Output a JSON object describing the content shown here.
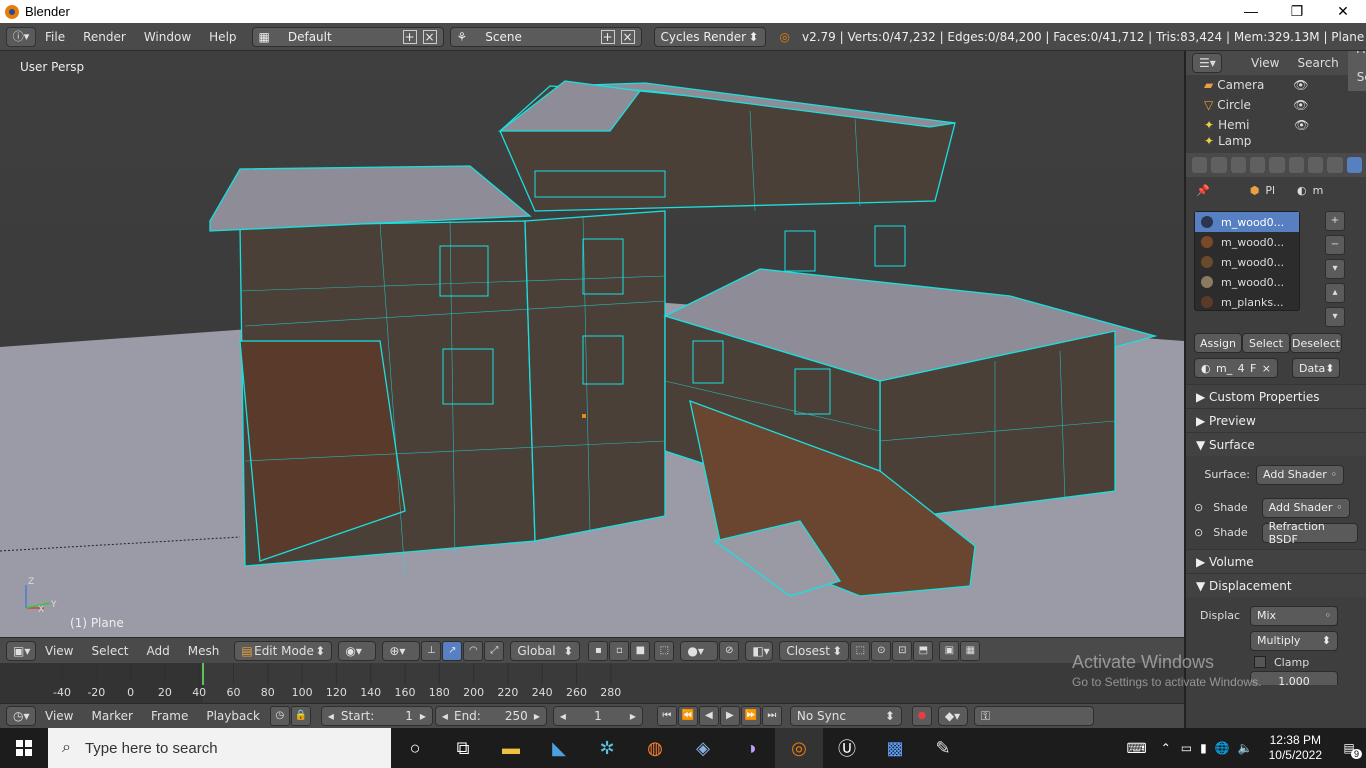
{
  "window": {
    "title": "Blender",
    "minimize": "—",
    "maximize": "❐",
    "close": "✕"
  },
  "infobar": {
    "menus": [
      "File",
      "Render",
      "Window",
      "Help"
    ],
    "screen_layout": "Default",
    "scene": "Scene",
    "render_engine": "Cycles Render",
    "stats": "v2.79 | Verts:0/47,232 | Edges:0/84,200 | Faces:0/41,712 | Tris:83,424 | Mem:329.13M | Plane"
  },
  "viewport": {
    "view_label": "User Persp",
    "object_label": "(1) Plane",
    "axis_x": "X",
    "axis_y": "Y",
    "axis_z": "Z"
  },
  "view_header": {
    "menus": [
      "View",
      "Select",
      "Add",
      "Mesh"
    ],
    "mode": "Edit Mode",
    "orientation": "Global",
    "snap_target": "Closest"
  },
  "timeline": {
    "ticks": [
      "-40",
      "-20",
      "0",
      "20",
      "40",
      "60",
      "80",
      "100",
      "120",
      "140",
      "160",
      "180",
      "200",
      "220",
      "240",
      "260",
      "280"
    ],
    "current_frame": 1
  },
  "timeline_header": {
    "menus": [
      "View",
      "Marker",
      "Frame",
      "Playback"
    ],
    "start_label": "Start:",
    "start_value": "1",
    "end_label": "End:",
    "end_value": "250",
    "current_value": "1",
    "sync": "No Sync"
  },
  "outliner": {
    "header": [
      "View",
      "Search",
      "All Sc"
    ],
    "items": [
      "Camera",
      "Circle",
      "Hemi",
      "Lamp"
    ]
  },
  "properties": {
    "breadcrumb": [
      "Pl",
      "m"
    ],
    "materials": [
      {
        "name": "m_wood0...",
        "color": "#2a3550"
      },
      {
        "name": "m_wood0...",
        "color": "#7a4a28"
      },
      {
        "name": "m_wood0...",
        "color": "#6a4a2a"
      },
      {
        "name": "m_wood0...",
        "color": "#8a7a60"
      },
      {
        "name": "m_planks...",
        "color": "#5a3a28"
      }
    ],
    "assign": "Assign",
    "select": "Select",
    "deselect": "Deselect",
    "material_field": "m_",
    "users": "4",
    "fake": "F",
    "data": "Data",
    "sections": {
      "custom": "Custom Properties",
      "preview": "Preview",
      "surface": "Surface",
      "volume": "Volume",
      "displacement": "Displacement"
    },
    "surface_label": "Surface:",
    "surface_value": "Add Shader",
    "shade1_label": "Shade",
    "shade1_value": "Add Shader",
    "shade2_label": "Shade",
    "shade2_value": "Refraction BSDF",
    "displac_label": "Displac",
    "displac_value": "Mix",
    "multiply": "Multiply",
    "clamp": "Clamp",
    "fac_value": "1.000"
  },
  "watermark": {
    "line1": "Activate Windows",
    "line2": "Go to Settings to activate Windows."
  },
  "taskbar": {
    "search_placeholder": "Type here to search",
    "time": "12:38 PM",
    "date": "10/5/2022",
    "notification_count": "9"
  },
  "colors": {
    "wire": "#19e0e0",
    "accent": "#5680c2",
    "blender_orange": "#e87d0d"
  }
}
